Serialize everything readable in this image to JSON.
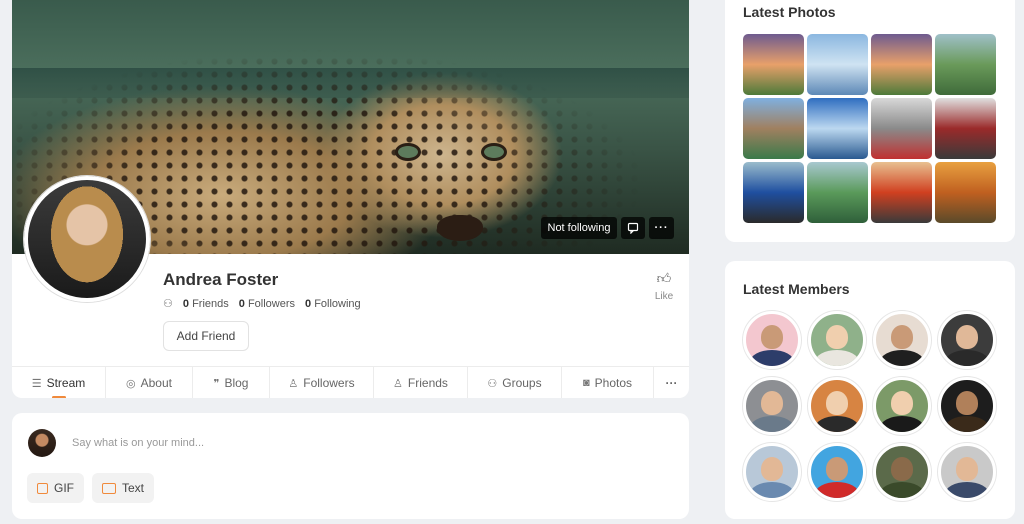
{
  "profile": {
    "name": "Andrea Foster",
    "stats": [
      {
        "count": "0",
        "label": "Friends"
      },
      {
        "count": "0",
        "label": "Followers"
      },
      {
        "count": "0",
        "label": "Following"
      }
    ],
    "add_friend_label": "Add Friend",
    "like_label": "Like",
    "follow_status": "Not following"
  },
  "tabs": [
    {
      "label": "Stream",
      "icon": "stream-icon",
      "glyph": "☰"
    },
    {
      "label": "About",
      "icon": "user-circle-icon",
      "glyph": "◎"
    },
    {
      "label": "Blog",
      "icon": "quote-icon",
      "glyph": "❞"
    },
    {
      "label": "Followers",
      "icon": "user-add-icon",
      "glyph": "♙"
    },
    {
      "label": "Friends",
      "icon": "users-icon",
      "glyph": "♙"
    },
    {
      "label": "Groups",
      "icon": "group-icon",
      "glyph": "⚇"
    },
    {
      "label": "Photos",
      "icon": "camera-icon",
      "glyph": "◙"
    }
  ],
  "post": {
    "placeholder": "Say what is on your mind...",
    "gif_label": "GIF",
    "text_label": "Text"
  },
  "latest_photos": {
    "title": "Latest Photos",
    "items": [
      "mountain-sunset-photo",
      "lone-tree-photo",
      "mountain-sunset-photo",
      "green-valley-photo",
      "alpine-lake-photo",
      "blue-lake-photo",
      "white-motorcycle-photo",
      "red-motorcycle-photo",
      "blue-motorcycle-photo",
      "green-river-photo",
      "orange-motorcycle-photo",
      "autumn-trees-photo"
    ],
    "colors": [
      [
        "#6e5b8f",
        "#e8a06a",
        "#4d7a3a"
      ],
      [
        "#8bb7e0",
        "#cfe3f2",
        "#5d88b6"
      ],
      [
        "#6e5b8f",
        "#e8a06a",
        "#4d7a3a"
      ],
      [
        "#9fc0c8",
        "#6a9a5a",
        "#3f6b3a"
      ],
      [
        "#7fb0e0",
        "#a08060",
        "#3a7a4a"
      ],
      [
        "#2f6ec0",
        "#bcd8f0",
        "#2a5a90"
      ],
      [
        "#d8d8d8",
        "#8a8a8a",
        "#c03030"
      ],
      [
        "#e0e0e0",
        "#9a2a2a",
        "#3a3a3a"
      ],
      [
        "#9abccc",
        "#1f4fa0",
        "#2a2a2a"
      ],
      [
        "#a8c8d0",
        "#5a9a5a",
        "#2f5f3a"
      ],
      [
        "#e8c090",
        "#d04020",
        "#3a3a3a"
      ],
      [
        "#e8a040",
        "#c06020",
        "#5a4a2a"
      ]
    ]
  },
  "latest_members": {
    "title": "Latest Members",
    "members": [
      {
        "bg": "#f3c7cf",
        "skin": "#c99a77",
        "shirt": "#2d3d6a"
      },
      {
        "bg": "#8fb18a",
        "skin": "#f0cfae",
        "shirt": "#e9e6df"
      },
      {
        "bg": "#e7dcd2",
        "skin": "#c99a77",
        "shirt": "#1f1f1f"
      },
      {
        "bg": "#3c3c3c",
        "skin": "#e0b898",
        "shirt": "#2a2a2a"
      },
      {
        "bg": "#8d8f93",
        "skin": "#e2b896",
        "shirt": "#6a7a8a"
      },
      {
        "bg": "#d78442",
        "skin": "#f0cfae",
        "shirt": "#2a2a2a"
      },
      {
        "bg": "#7c9a68",
        "skin": "#f0cfae",
        "shirt": "#1a1a1a"
      },
      {
        "bg": "#1d1d1d",
        "skin": "#b0805a",
        "shirt": "#3a2a1a"
      },
      {
        "bg": "#b8c8d8",
        "skin": "#e2b896",
        "shirt": "#6a8ab0"
      },
      {
        "bg": "#42a5e0",
        "skin": "#c99a77",
        "shirt": "#d02a2a"
      },
      {
        "bg": "#5b6a4a",
        "skin": "#8a6a4a",
        "shirt": "#3a4a2a"
      },
      {
        "bg": "#c9c9c9",
        "skin": "#e2b896",
        "shirt": "#3a4a6a"
      }
    ]
  }
}
